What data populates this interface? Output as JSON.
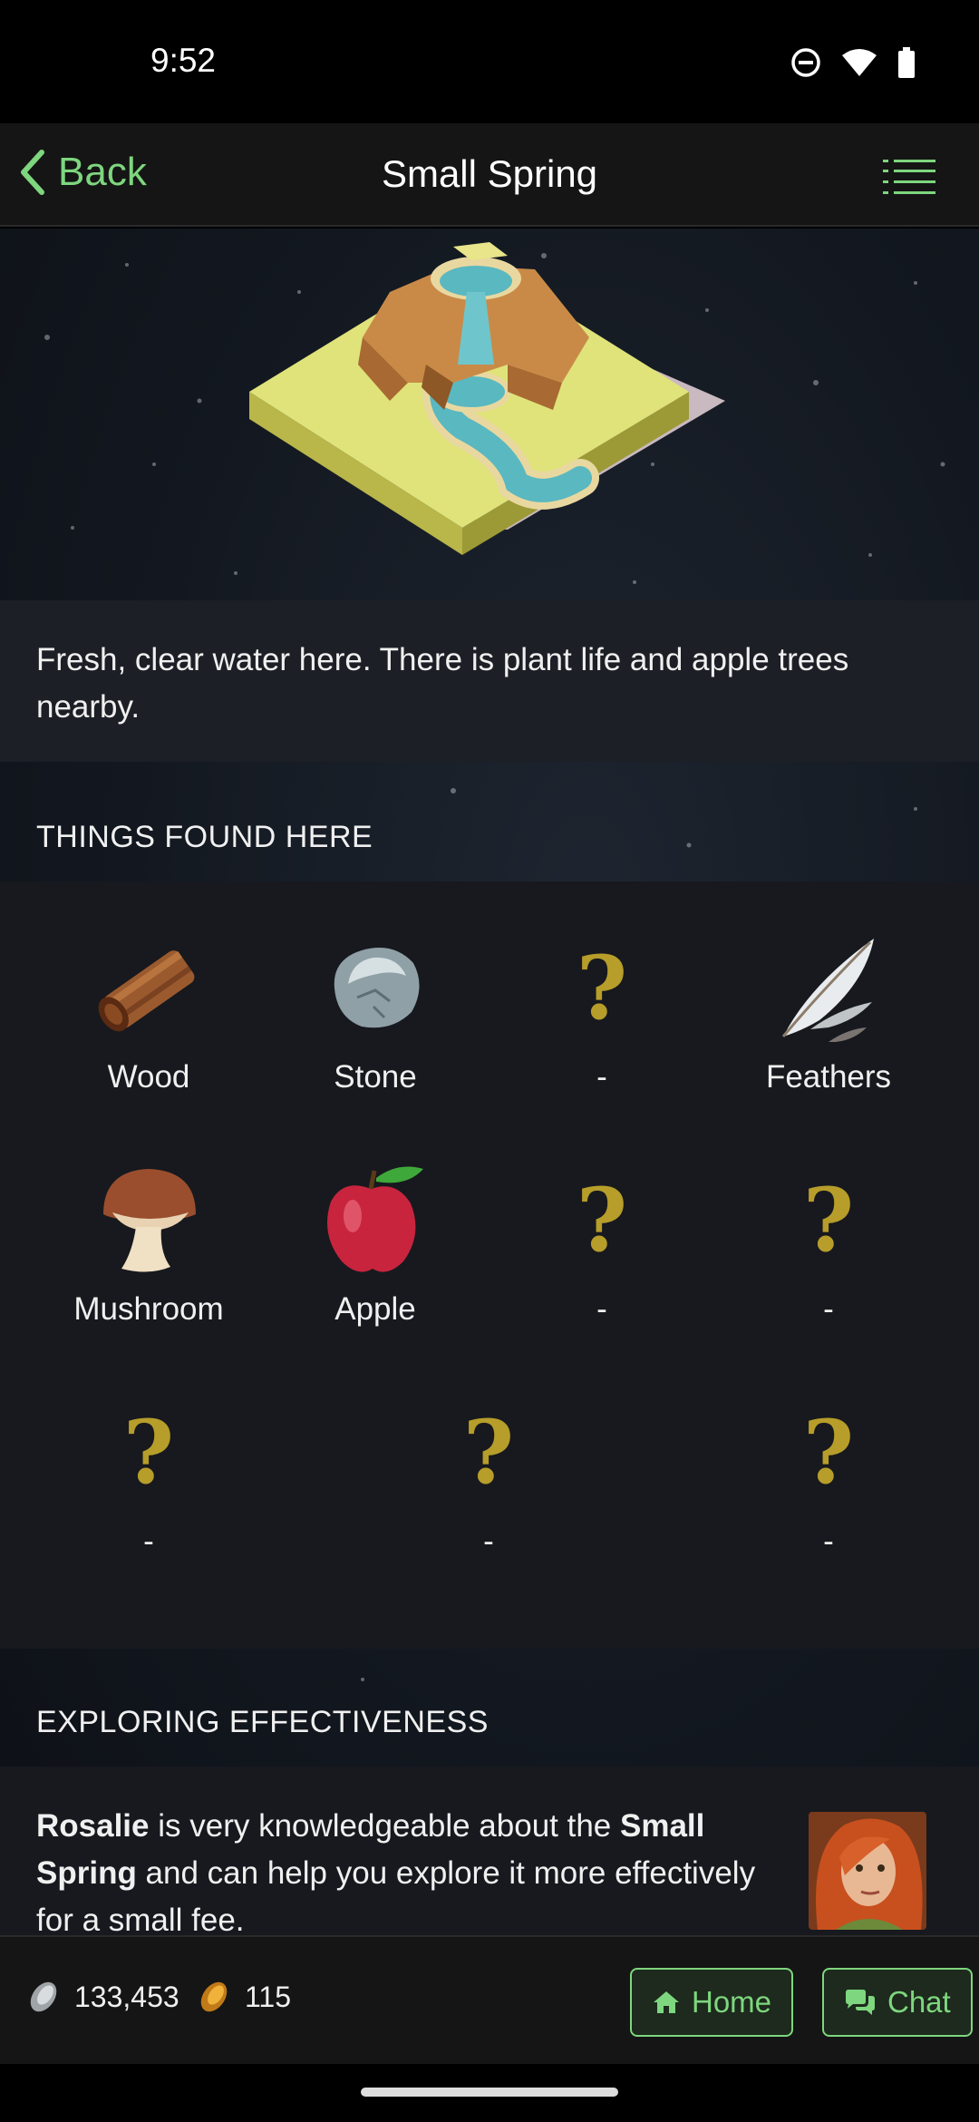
{
  "status_bar": {
    "time": "9:52"
  },
  "nav": {
    "back_label": "Back",
    "title": "Small Spring"
  },
  "location": {
    "description": "Fresh, clear water here. There is plant life and apple trees nearby."
  },
  "things_found": {
    "header": "THINGS FOUND HERE",
    "items": [
      {
        "label": "Wood",
        "icon": "wood-icon"
      },
      {
        "label": "Stone",
        "icon": "stone-icon"
      },
      {
        "label": "-",
        "icon": "unknown-icon"
      },
      {
        "label": "Feathers",
        "icon": "feathers-icon"
      },
      {
        "label": "Mushroom",
        "icon": "mushroom-icon"
      },
      {
        "label": "Apple",
        "icon": "apple-icon"
      },
      {
        "label": "-",
        "icon": "unknown-icon"
      },
      {
        "label": "-",
        "icon": "unknown-icon"
      },
      {
        "label": "-",
        "icon": "unknown-icon"
      },
      {
        "label": "-",
        "icon": "unknown-icon"
      },
      {
        "label": "-",
        "icon": "unknown-icon"
      }
    ],
    "unknown_symbol": "?"
  },
  "exploring": {
    "header": "EXPLORING EFFECTIVENESS",
    "helper_name": "Rosalie",
    "text_1": " is very knowledgeable about the ",
    "location_name": "Small Spring",
    "text_2": " and can help you explore it more effectively for a small fee."
  },
  "bottom_bar": {
    "silver": "133,453",
    "gold": "115",
    "home_label": "Home",
    "chat_label": "Chat"
  },
  "colors": {
    "accent": "#7ed67e",
    "question": "#b79d2a",
    "background": "#131820"
  }
}
